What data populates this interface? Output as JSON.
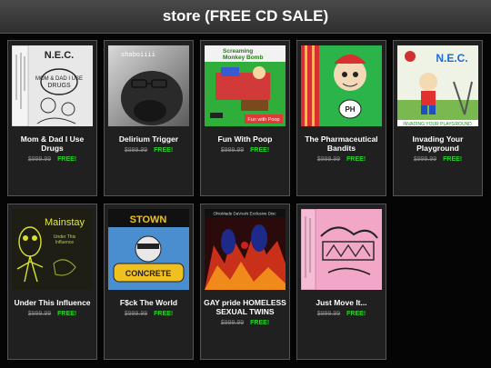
{
  "header": {
    "title": "store (FREE CD SALE)"
  },
  "products": [
    {
      "name": "Mom & Dad I Use Drugs",
      "old_price": "$999.99",
      "price": "FREE!",
      "art_text": "N.E.C.",
      "art_icon": "tape-cover-art"
    },
    {
      "name": "Delirium Trigger",
      "old_price": "$999.99",
      "price": "FREE!",
      "art_text": "shaboiiii",
      "art_icon": "photo-cover-art"
    },
    {
      "name": "Fun With Poop",
      "old_price": "$999.99",
      "price": "FREE!",
      "art_text": "Fun with Poop",
      "art_icon": "cartoon-cover-art"
    },
    {
      "name": "The Pharmaceutical Bandits",
      "old_price": "$999.99",
      "price": "FREE!",
      "art_text": "PH",
      "art_icon": "cartoon-cover-art"
    },
    {
      "name": "Invading Your Playground",
      "old_price": "$999.99",
      "price": "FREE!",
      "art_text": "N.E.C.",
      "art_icon": "cartoon-cover-art"
    },
    {
      "name": "Under This Influence",
      "old_price": "$999.99",
      "price": "FREE!",
      "art_text": "Mainstay",
      "art_icon": "sketch-cover-art"
    },
    {
      "name": "F$ck The World",
      "old_price": "$999.99",
      "price": "FREE!",
      "art_text": "STOWN",
      "art_icon": "graffiti-cover-art"
    },
    {
      "name": "GAY pride HOMELESS SEXUAL TWINS",
      "old_price": "$999.99",
      "price": "FREE!",
      "art_text": "",
      "art_icon": "photo-cover-art"
    },
    {
      "name": "Just Move It...",
      "old_price": "$999.99",
      "price": "FREE!",
      "art_text": "",
      "art_icon": "tape-cover-art"
    }
  ],
  "colors": {
    "free": "#2ad02a",
    "old_price": "#888888",
    "card_bg": "#202020"
  }
}
